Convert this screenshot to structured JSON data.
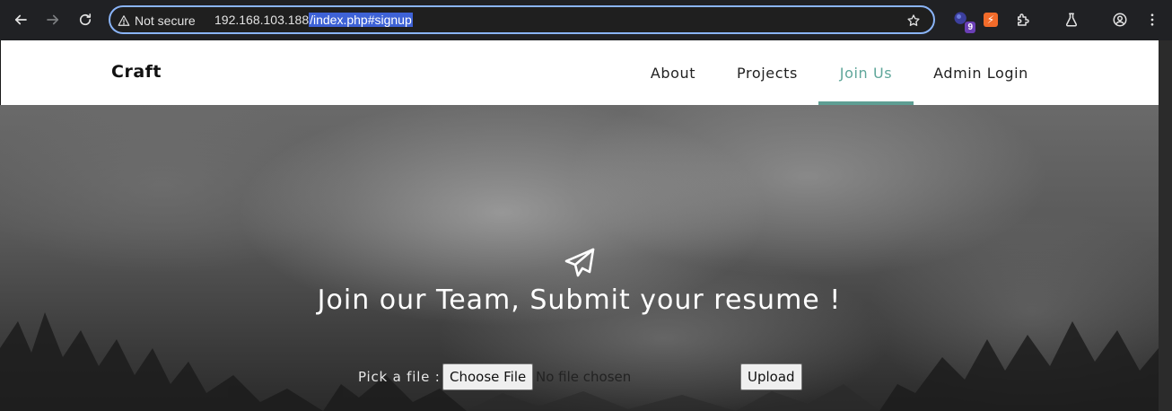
{
  "browser": {
    "security_label": "Not secure",
    "url_host": "192.168.103.188",
    "url_path": "/index.php#signup",
    "extension_badge_count": "9",
    "icons": [
      "back-icon",
      "forward-icon",
      "reload-icon",
      "warning-icon",
      "star-icon",
      "extension-icon",
      "puzzle-icon",
      "flask-icon",
      "profile-icon",
      "more-vert-icon"
    ],
    "accent_color": "#8ab4f8"
  },
  "navbar": {
    "brand": "Craft",
    "items": [
      {
        "label": "About",
        "active": false
      },
      {
        "label": "Projects",
        "active": false
      },
      {
        "label": "Join Us",
        "active": true
      },
      {
        "label": "Admin Login",
        "active": false
      }
    ],
    "active_color": "#5fa69a"
  },
  "hero": {
    "icon": "paper-plane-icon",
    "title": "Join our Team, Submit your resume !",
    "pick_label": "Pick a file :",
    "choose_file_label": "Choose File",
    "file_status": "No file chosen",
    "upload_label": "Upload"
  }
}
